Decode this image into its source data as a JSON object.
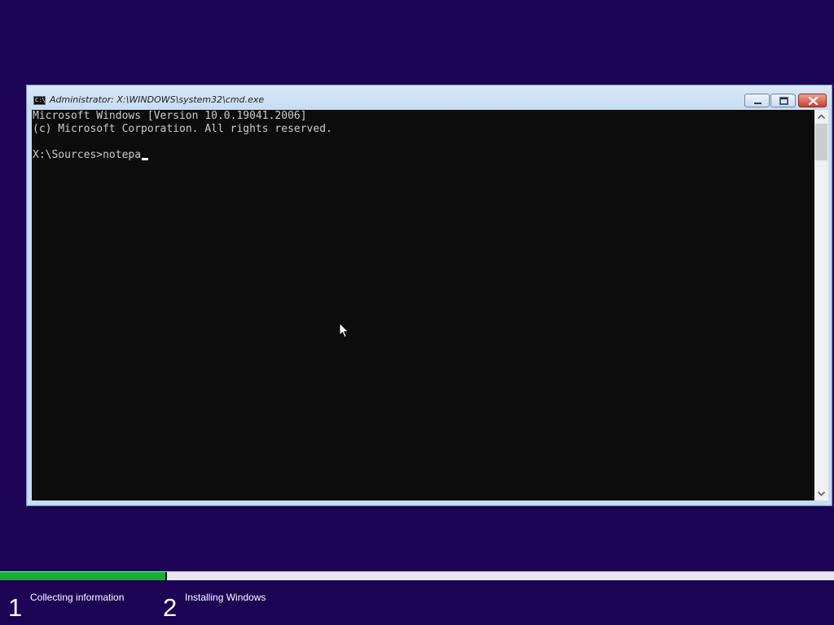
{
  "window": {
    "title": "Administrator: X:\\WINDOWS\\system32\\cmd.exe",
    "icon": "C:\\"
  },
  "console": {
    "lines": [
      "Microsoft Windows [Version 10.0.19041.2006]",
      "(c) Microsoft Corporation. All rights reserved.",
      "",
      "X:\\Sources>notepa"
    ]
  },
  "setup": {
    "progress": 0.2,
    "steps": [
      {
        "number": "1",
        "label": "Collecting information"
      },
      {
        "number": "2",
        "label": "Installing Windows"
      }
    ]
  },
  "colors": {
    "background": "#1c0354",
    "progress_fill": "#16b12e",
    "console_bg": "#0c0c0c",
    "console_text": "#cccccc"
  }
}
